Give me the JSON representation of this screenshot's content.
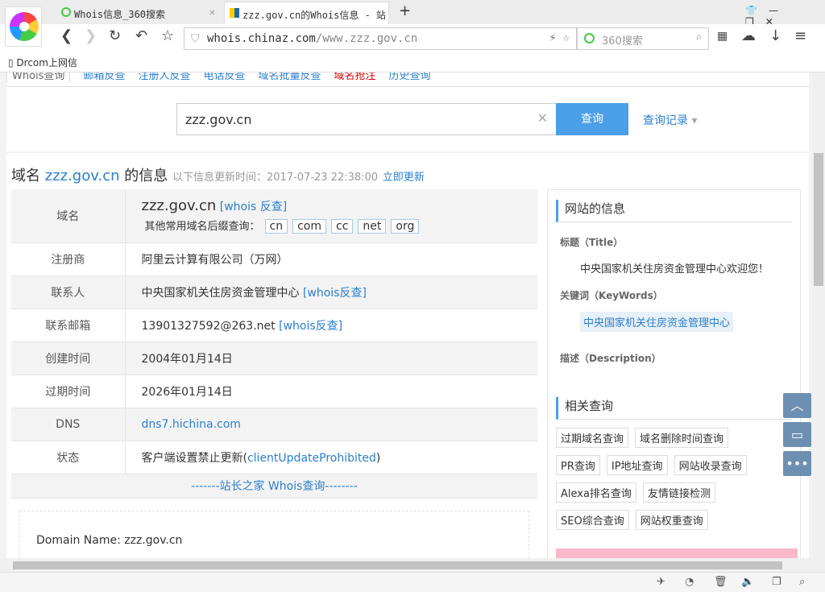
{
  "browser": {
    "tabs": [
      {
        "title": "Whois信息_360搜索"
      },
      {
        "title": "zzz.gov.cn的Whois信息 - 站"
      }
    ],
    "url_host": "whois.chinaz.com",
    "url_path": "/www.zzz.gov.cn",
    "search_placeholder": "360搜索",
    "bookmark": "Drcom上网信"
  },
  "nav": [
    "Whois查询",
    "邮箱反查",
    "注册人反查",
    "电话反查",
    "域名批量反查",
    "域名抢注",
    "历史查询"
  ],
  "search": {
    "value": "zzz.gov.cn",
    "button": "查询",
    "history": "查询记录"
  },
  "header": {
    "prefix": "域名",
    "domain": "zzz.gov.cn",
    "suffix": "的信息",
    "update_label": "以下信息更新时间：2017-07-23 22:38:00",
    "update_link": "立即更新"
  },
  "info": {
    "domain_label": "域名",
    "domain": "zzz.gov.cn",
    "whois_rev": "[whois 反查]",
    "suffix_label": "其他常用域名后缀查询：",
    "suffixes": [
      "cn",
      "com",
      "cc",
      "net",
      "org"
    ],
    "rows": [
      {
        "k": "注册商",
        "v": "阿里云计算有限公司（万网）",
        "link": ""
      },
      {
        "k": "联系人",
        "v": "中央国家机关住房资金管理中心",
        "link": "[whois反查]"
      },
      {
        "k": "联系邮箱",
        "v": "13901327592@263.net",
        "link": "[whois反查]"
      },
      {
        "k": "创建时间",
        "v": "2004年01月14日",
        "link": ""
      },
      {
        "k": "过期时间",
        "v": "2026年01月14日",
        "link": ""
      },
      {
        "k": "DNS",
        "v": "dns7.hichina.com",
        "link": ""
      },
      {
        "k": "状态",
        "v": "客户端设置禁止更新(",
        "link": "clientUpdateProhibited",
        "end": ")"
      }
    ],
    "footer": "-------站长之家 Whois查询--------",
    "raw": "Domain Name: zzz.gov.cn"
  },
  "side": {
    "site_title": "网站的信息",
    "title_label": "标题（Title）",
    "title_value": "中央国家机关住房资金管理中心欢迎您！",
    "kw_label": "关键词（KeyWords）",
    "kw_value": "中央国家机关住房资金管理中心",
    "desc_label": "描述（Description）",
    "related_title": "相关查询",
    "related": [
      "过期域名查询",
      "域名删除时间查询",
      "PR查询",
      "IP地址查询",
      "网站收录查询",
      "Alexa排名查询",
      "友情链接检测",
      "SEO综合查询",
      "网站权重查询"
    ]
  }
}
